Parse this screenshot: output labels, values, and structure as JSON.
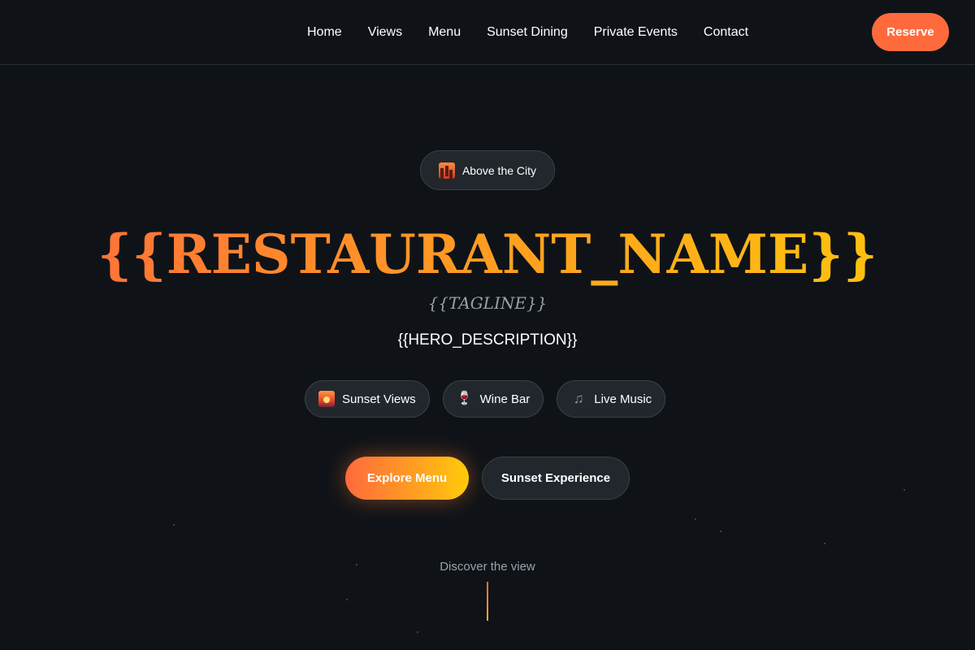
{
  "nav": {
    "links": [
      "Home",
      "Views",
      "Menu",
      "Sunset Dining",
      "Private Events",
      "Contact"
    ],
    "reserve_label": "Reserve"
  },
  "hero": {
    "badge": {
      "icon": "cityscape-icon",
      "label": "Above the City"
    },
    "title": "{{RESTAURANT_NAME}}",
    "tagline": "{{TAGLINE}}",
    "description": "{{HERO_DESCRIPTION}}",
    "features": [
      {
        "icon": "sunset-icon",
        "label": "Sunset Views"
      },
      {
        "icon": "wine-glass-icon",
        "label": "Wine Bar"
      },
      {
        "icon": "music-notes-icon",
        "label": "Live Music"
      }
    ],
    "primary_button": "Explore Menu",
    "secondary_button": "Sunset Experience",
    "scroll_hint": "Discover the view"
  },
  "colors": {
    "background": "#0f1318",
    "accent": "#ff6a3d",
    "accent_gradient_end": "#ffcb0a",
    "pill_background": "#22272d",
    "muted_text": "#9aa1aa"
  }
}
